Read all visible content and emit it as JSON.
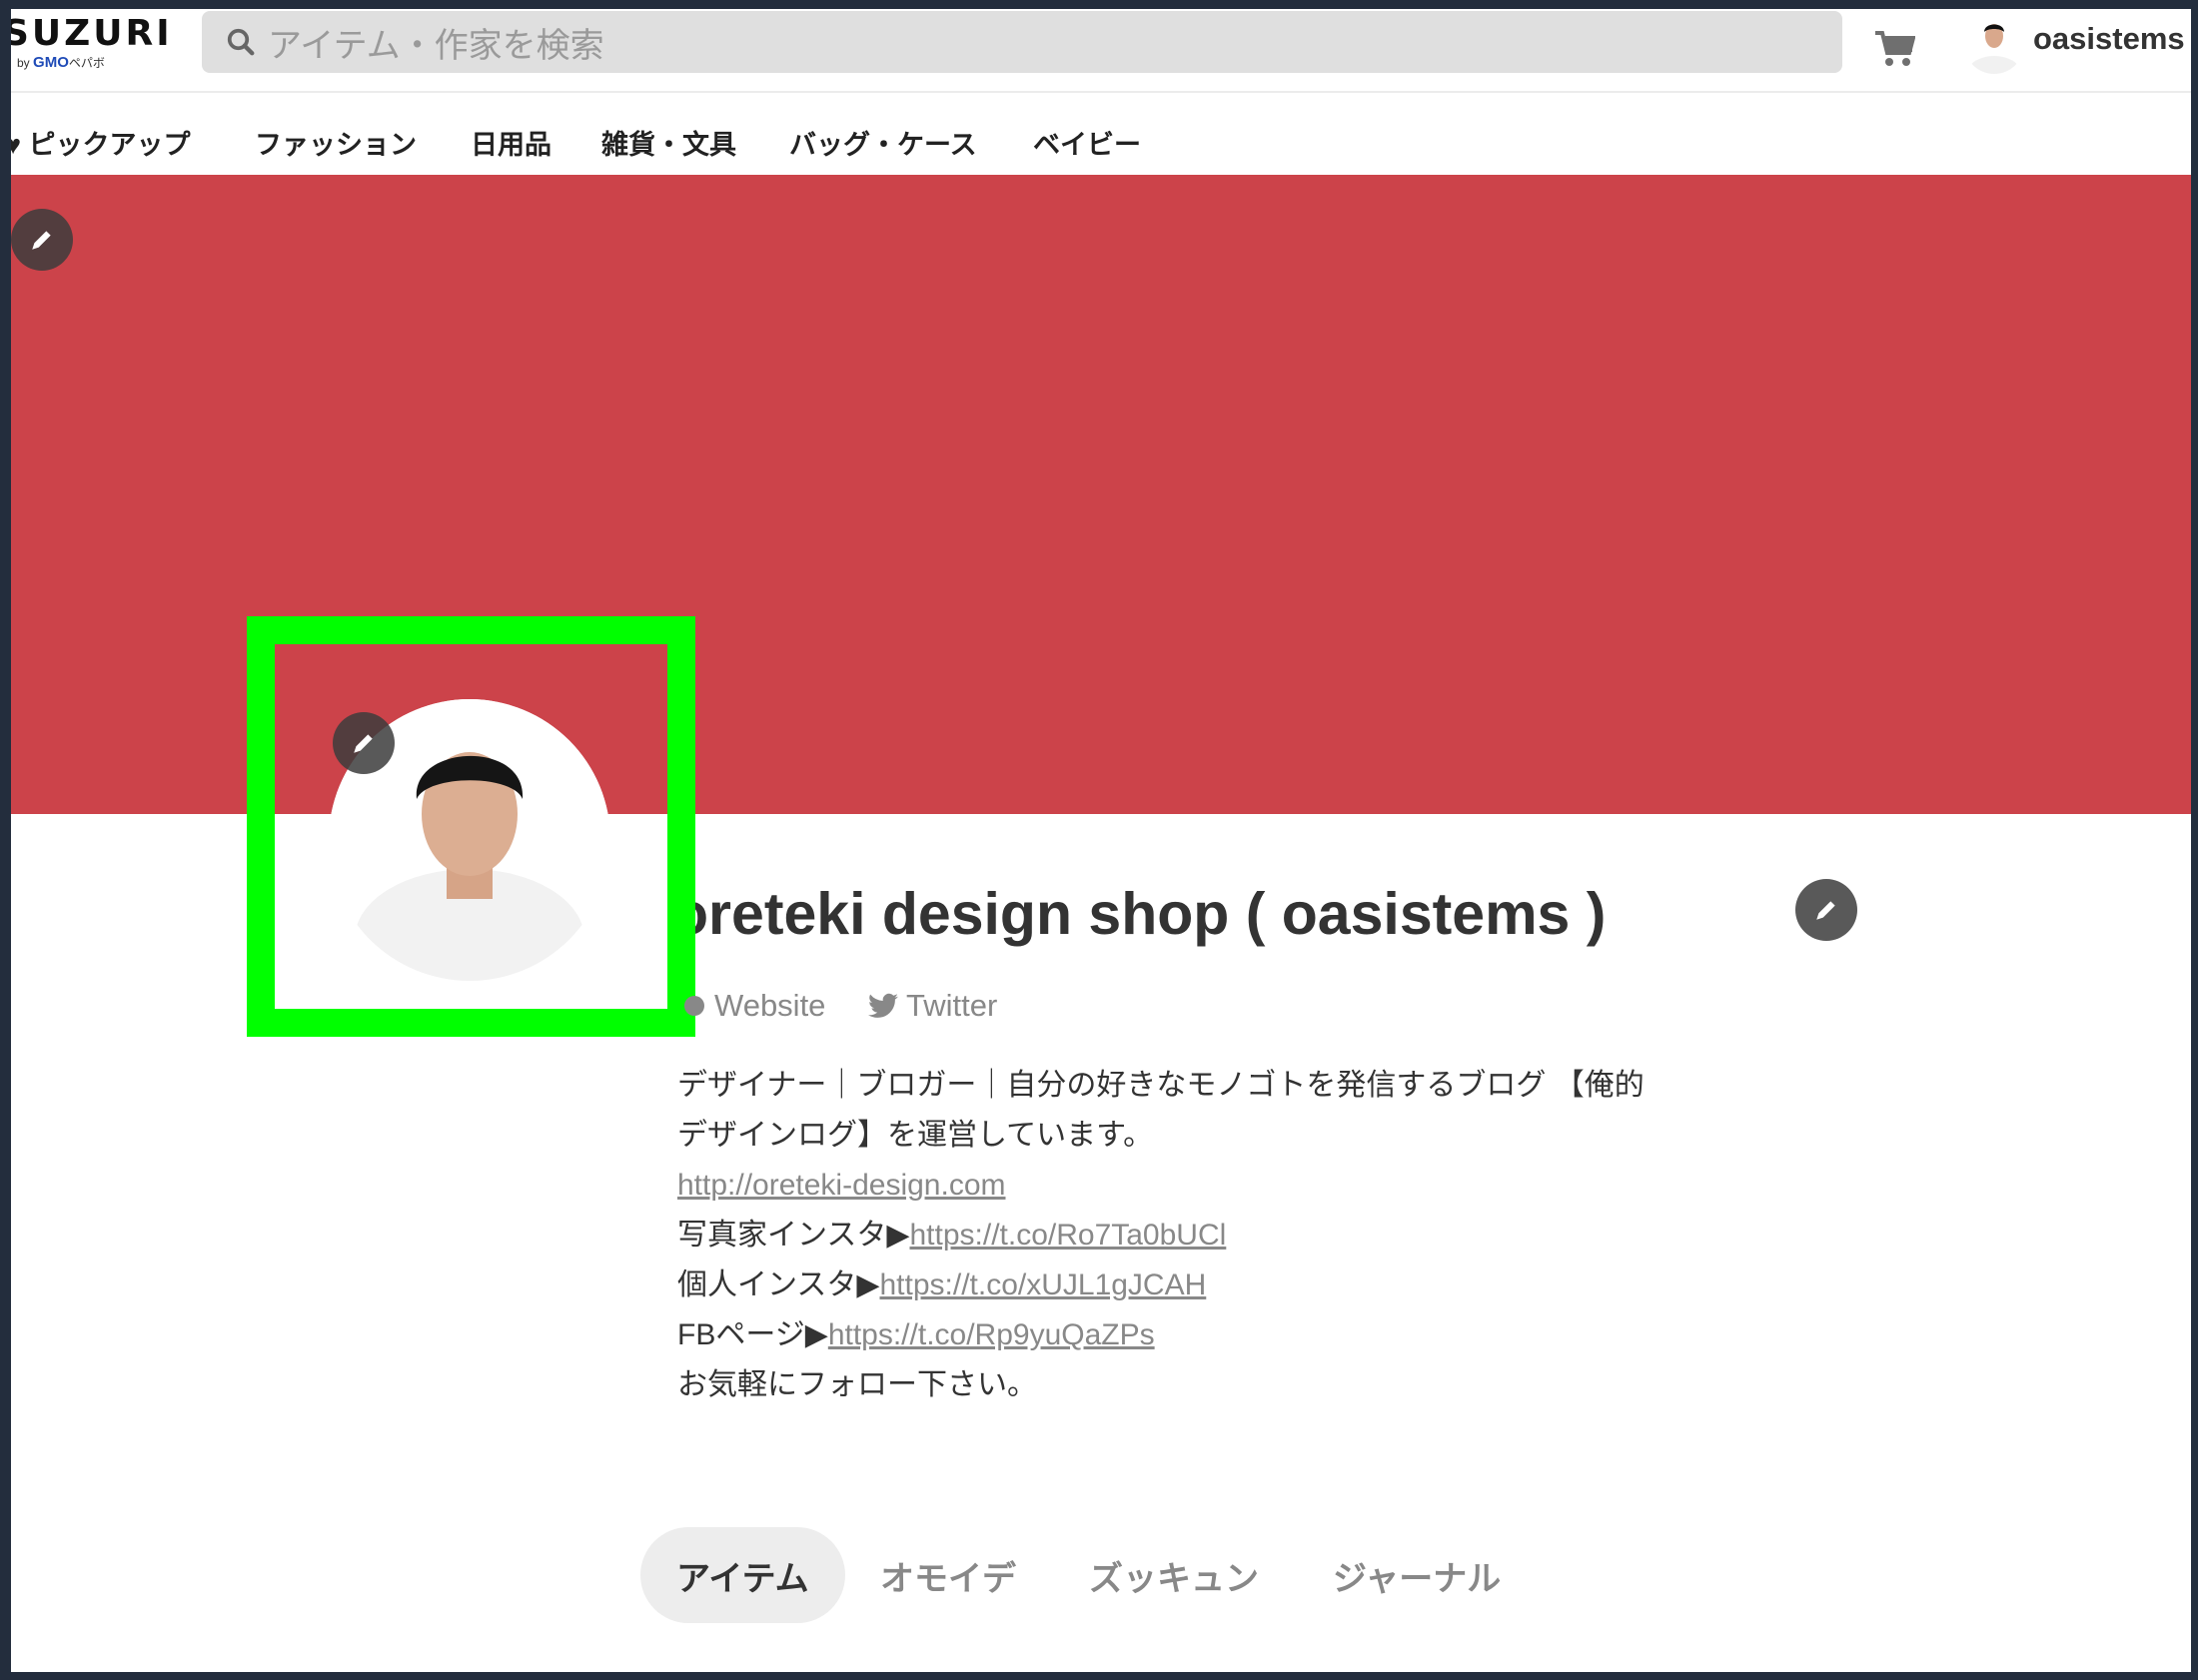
{
  "header": {
    "logo": "SUZURI",
    "logo_sub_by": "by",
    "logo_sub_brand": "GMO",
    "logo_sub_suffix": "ペパボ",
    "search_placeholder": "アイテム・作家を検索",
    "username": "oasistems"
  },
  "nav": {
    "items": [
      {
        "label": "ピックアップ",
        "icon": "heart-icon"
      },
      {
        "label": "ファッション"
      },
      {
        "label": "日用品"
      },
      {
        "label": "雑貨・文具"
      },
      {
        "label": "バッグ・ケース"
      },
      {
        "label": "ベイビー"
      }
    ]
  },
  "banner": {
    "color": "#cc434a"
  },
  "highlight": {
    "color": "#00ff00"
  },
  "profile": {
    "title": "oreteki design shop ( oasistems )",
    "links": [
      {
        "label": "Website",
        "icon": "globe-icon"
      },
      {
        "label": "Twitter",
        "icon": "twitter-icon"
      }
    ],
    "bio": {
      "line1": "デザイナー｜ブロガー｜自分の好きなモノゴトを発信するブログ 【俺的",
      "line2": "デザインログ】を運営しています。",
      "url1": "http://oreteki-design.com",
      "line4_prefix": "写真家インスタ▶",
      "url2": "https://t.co/Ro7Ta0bUCl",
      "line5_prefix": "個人インスタ▶",
      "url3": "https://t.co/xUJL1gJCAH",
      "line6_prefix": "FBページ▶",
      "url4": "https://t.co/Rp9yuQaZPs",
      "line7": "お気軽にフォロー下さい。"
    }
  },
  "tabs": [
    {
      "label": "アイテム",
      "active": true
    },
    {
      "label": "オモイデ"
    },
    {
      "label": "ズッキュン"
    },
    {
      "label": "ジャーナル"
    }
  ]
}
